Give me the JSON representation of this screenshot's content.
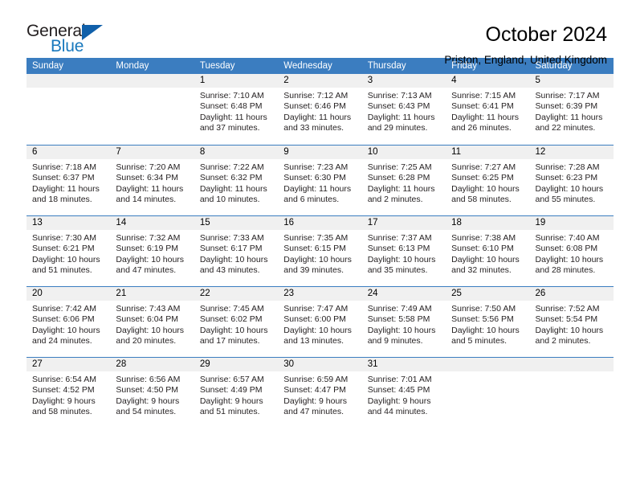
{
  "brand": {
    "name_top": "General",
    "name_bottom": "Blue",
    "accent_color": "#1878bd",
    "triangle_color": "#1060aa"
  },
  "header": {
    "title": "October 2024",
    "subtitle": "Priston, England, United Kingdom"
  },
  "theme": {
    "header_blue": "#3b7dc0",
    "day_band_gray": "#f0f0f0",
    "text_color": "#231f20"
  },
  "weekdays": [
    "Sunday",
    "Monday",
    "Tuesday",
    "Wednesday",
    "Thursday",
    "Friday",
    "Saturday"
  ],
  "weeks": [
    [
      {
        "day": "",
        "sunrise": "",
        "sunset": "",
        "daylight_line1": "",
        "daylight_line2": "",
        "empty": true
      },
      {
        "day": "",
        "sunrise": "",
        "sunset": "",
        "daylight_line1": "",
        "daylight_line2": "",
        "empty": true
      },
      {
        "day": "1",
        "sunrise": "Sunrise: 7:10 AM",
        "sunset": "Sunset: 6:48 PM",
        "daylight_line1": "Daylight: 11 hours",
        "daylight_line2": "and 37 minutes."
      },
      {
        "day": "2",
        "sunrise": "Sunrise: 7:12 AM",
        "sunset": "Sunset: 6:46 PM",
        "daylight_line1": "Daylight: 11 hours",
        "daylight_line2": "and 33 minutes."
      },
      {
        "day": "3",
        "sunrise": "Sunrise: 7:13 AM",
        "sunset": "Sunset: 6:43 PM",
        "daylight_line1": "Daylight: 11 hours",
        "daylight_line2": "and 29 minutes."
      },
      {
        "day": "4",
        "sunrise": "Sunrise: 7:15 AM",
        "sunset": "Sunset: 6:41 PM",
        "daylight_line1": "Daylight: 11 hours",
        "daylight_line2": "and 26 minutes."
      },
      {
        "day": "5",
        "sunrise": "Sunrise: 7:17 AM",
        "sunset": "Sunset: 6:39 PM",
        "daylight_line1": "Daylight: 11 hours",
        "daylight_line2": "and 22 minutes."
      }
    ],
    [
      {
        "day": "6",
        "sunrise": "Sunrise: 7:18 AM",
        "sunset": "Sunset: 6:37 PM",
        "daylight_line1": "Daylight: 11 hours",
        "daylight_line2": "and 18 minutes."
      },
      {
        "day": "7",
        "sunrise": "Sunrise: 7:20 AM",
        "sunset": "Sunset: 6:34 PM",
        "daylight_line1": "Daylight: 11 hours",
        "daylight_line2": "and 14 minutes."
      },
      {
        "day": "8",
        "sunrise": "Sunrise: 7:22 AM",
        "sunset": "Sunset: 6:32 PM",
        "daylight_line1": "Daylight: 11 hours",
        "daylight_line2": "and 10 minutes."
      },
      {
        "day": "9",
        "sunrise": "Sunrise: 7:23 AM",
        "sunset": "Sunset: 6:30 PM",
        "daylight_line1": "Daylight: 11 hours",
        "daylight_line2": "and 6 minutes."
      },
      {
        "day": "10",
        "sunrise": "Sunrise: 7:25 AM",
        "sunset": "Sunset: 6:28 PM",
        "daylight_line1": "Daylight: 11 hours",
        "daylight_line2": "and 2 minutes."
      },
      {
        "day": "11",
        "sunrise": "Sunrise: 7:27 AM",
        "sunset": "Sunset: 6:25 PM",
        "daylight_line1": "Daylight: 10 hours",
        "daylight_line2": "and 58 minutes."
      },
      {
        "day": "12",
        "sunrise": "Sunrise: 7:28 AM",
        "sunset": "Sunset: 6:23 PM",
        "daylight_line1": "Daylight: 10 hours",
        "daylight_line2": "and 55 minutes."
      }
    ],
    [
      {
        "day": "13",
        "sunrise": "Sunrise: 7:30 AM",
        "sunset": "Sunset: 6:21 PM",
        "daylight_line1": "Daylight: 10 hours",
        "daylight_line2": "and 51 minutes."
      },
      {
        "day": "14",
        "sunrise": "Sunrise: 7:32 AM",
        "sunset": "Sunset: 6:19 PM",
        "daylight_line1": "Daylight: 10 hours",
        "daylight_line2": "and 47 minutes."
      },
      {
        "day": "15",
        "sunrise": "Sunrise: 7:33 AM",
        "sunset": "Sunset: 6:17 PM",
        "daylight_line1": "Daylight: 10 hours",
        "daylight_line2": "and 43 minutes."
      },
      {
        "day": "16",
        "sunrise": "Sunrise: 7:35 AM",
        "sunset": "Sunset: 6:15 PM",
        "daylight_line1": "Daylight: 10 hours",
        "daylight_line2": "and 39 minutes."
      },
      {
        "day": "17",
        "sunrise": "Sunrise: 7:37 AM",
        "sunset": "Sunset: 6:13 PM",
        "daylight_line1": "Daylight: 10 hours",
        "daylight_line2": "and 35 minutes."
      },
      {
        "day": "18",
        "sunrise": "Sunrise: 7:38 AM",
        "sunset": "Sunset: 6:10 PM",
        "daylight_line1": "Daylight: 10 hours",
        "daylight_line2": "and 32 minutes."
      },
      {
        "day": "19",
        "sunrise": "Sunrise: 7:40 AM",
        "sunset": "Sunset: 6:08 PM",
        "daylight_line1": "Daylight: 10 hours",
        "daylight_line2": "and 28 minutes."
      }
    ],
    [
      {
        "day": "20",
        "sunrise": "Sunrise: 7:42 AM",
        "sunset": "Sunset: 6:06 PM",
        "daylight_line1": "Daylight: 10 hours",
        "daylight_line2": "and 24 minutes."
      },
      {
        "day": "21",
        "sunrise": "Sunrise: 7:43 AM",
        "sunset": "Sunset: 6:04 PM",
        "daylight_line1": "Daylight: 10 hours",
        "daylight_line2": "and 20 minutes."
      },
      {
        "day": "22",
        "sunrise": "Sunrise: 7:45 AM",
        "sunset": "Sunset: 6:02 PM",
        "daylight_line1": "Daylight: 10 hours",
        "daylight_line2": "and 17 minutes."
      },
      {
        "day": "23",
        "sunrise": "Sunrise: 7:47 AM",
        "sunset": "Sunset: 6:00 PM",
        "daylight_line1": "Daylight: 10 hours",
        "daylight_line2": "and 13 minutes."
      },
      {
        "day": "24",
        "sunrise": "Sunrise: 7:49 AM",
        "sunset": "Sunset: 5:58 PM",
        "daylight_line1": "Daylight: 10 hours",
        "daylight_line2": "and 9 minutes."
      },
      {
        "day": "25",
        "sunrise": "Sunrise: 7:50 AM",
        "sunset": "Sunset: 5:56 PM",
        "daylight_line1": "Daylight: 10 hours",
        "daylight_line2": "and 5 minutes."
      },
      {
        "day": "26",
        "sunrise": "Sunrise: 7:52 AM",
        "sunset": "Sunset: 5:54 PM",
        "daylight_line1": "Daylight: 10 hours",
        "daylight_line2": "and 2 minutes."
      }
    ],
    [
      {
        "day": "27",
        "sunrise": "Sunrise: 6:54 AM",
        "sunset": "Sunset: 4:52 PM",
        "daylight_line1": "Daylight: 9 hours",
        "daylight_line2": "and 58 minutes."
      },
      {
        "day": "28",
        "sunrise": "Sunrise: 6:56 AM",
        "sunset": "Sunset: 4:50 PM",
        "daylight_line1": "Daylight: 9 hours",
        "daylight_line2": "and 54 minutes."
      },
      {
        "day": "29",
        "sunrise": "Sunrise: 6:57 AM",
        "sunset": "Sunset: 4:49 PM",
        "daylight_line1": "Daylight: 9 hours",
        "daylight_line2": "and 51 minutes."
      },
      {
        "day": "30",
        "sunrise": "Sunrise: 6:59 AM",
        "sunset": "Sunset: 4:47 PM",
        "daylight_line1": "Daylight: 9 hours",
        "daylight_line2": "and 47 minutes."
      },
      {
        "day": "31",
        "sunrise": "Sunrise: 7:01 AM",
        "sunset": "Sunset: 4:45 PM",
        "daylight_line1": "Daylight: 9 hours",
        "daylight_line2": "and 44 minutes."
      },
      {
        "day": "",
        "sunrise": "",
        "sunset": "",
        "daylight_line1": "",
        "daylight_line2": "",
        "empty": true
      },
      {
        "day": "",
        "sunrise": "",
        "sunset": "",
        "daylight_line1": "",
        "daylight_line2": "",
        "empty": true
      }
    ]
  ]
}
